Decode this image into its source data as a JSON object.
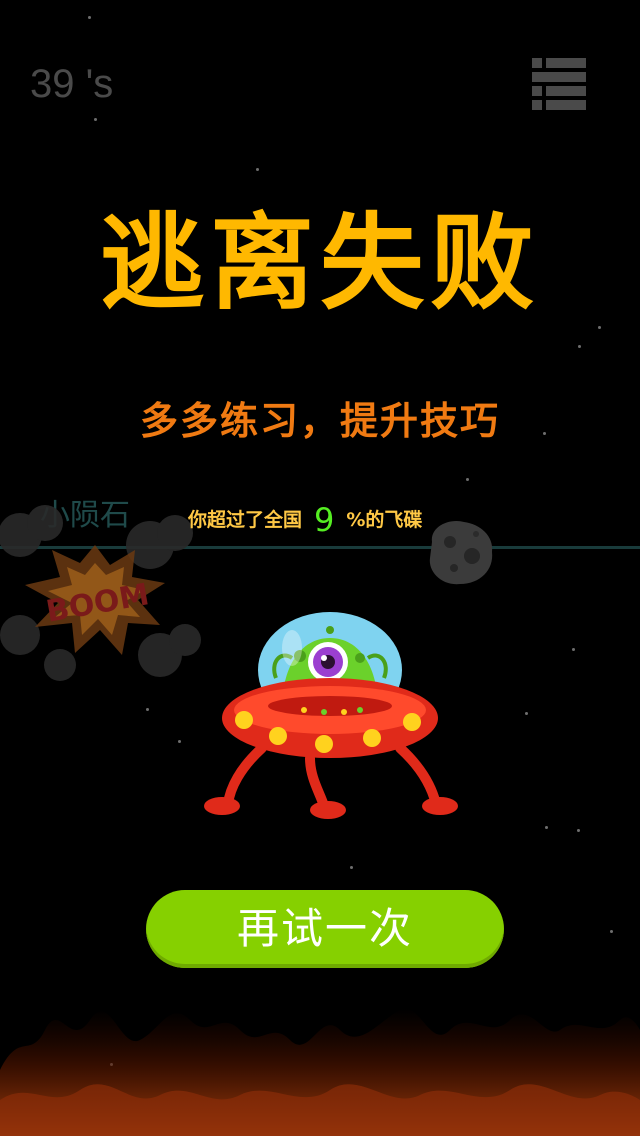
{
  "hud": {
    "timer_text": "39 's",
    "menu_icon": "hamburger-menu-icon"
  },
  "result": {
    "title": "逃离失败",
    "subtitle": "多多练习，提升技巧",
    "stat_prefix": "你超过了全国",
    "stat_percent": "9",
    "stat_suffix": "%的飞碟"
  },
  "game_scene": {
    "meteor_label": "小陨石",
    "explosion_text": "BOOM"
  },
  "actions": {
    "retry_label": "再试一次"
  },
  "colors": {
    "title": "#ffb800",
    "subtitle": "#f07a12",
    "stat_text": "#ffc845",
    "stat_number": "#55ee22",
    "retry_button": "#86d000",
    "background": "#000000"
  }
}
